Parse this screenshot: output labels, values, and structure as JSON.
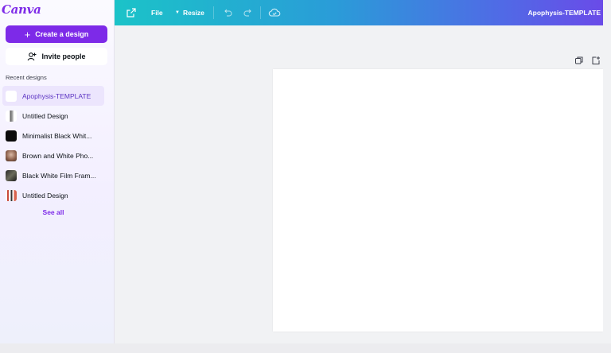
{
  "brand": {
    "logo_text": "Canva",
    "accent": "#7d2ae8"
  },
  "sidebar": {
    "create_label": "Create a design",
    "invite_label": "Invite people",
    "recent_title": "Recent designs",
    "recent": [
      {
        "label": "Apophysis-TEMPLATE",
        "active": true
      },
      {
        "label": "Untitled Design"
      },
      {
        "label": "Minimalist Black Whit..."
      },
      {
        "label": "Brown and White Pho..."
      },
      {
        "label": "Black White Film Fram..."
      },
      {
        "label": "Untitled Design"
      }
    ],
    "see_all": "See all"
  },
  "topbar": {
    "file_label": "File",
    "resize_label": "Resize",
    "design_title": "Apophysis-TEMPLATE",
    "icons": [
      "share-external-icon",
      "undo-icon",
      "redo-icon",
      "cloud-save-icon"
    ]
  },
  "canvas": {
    "page_icons": [
      "duplicate-page-icon",
      "add-page-icon"
    ]
  }
}
